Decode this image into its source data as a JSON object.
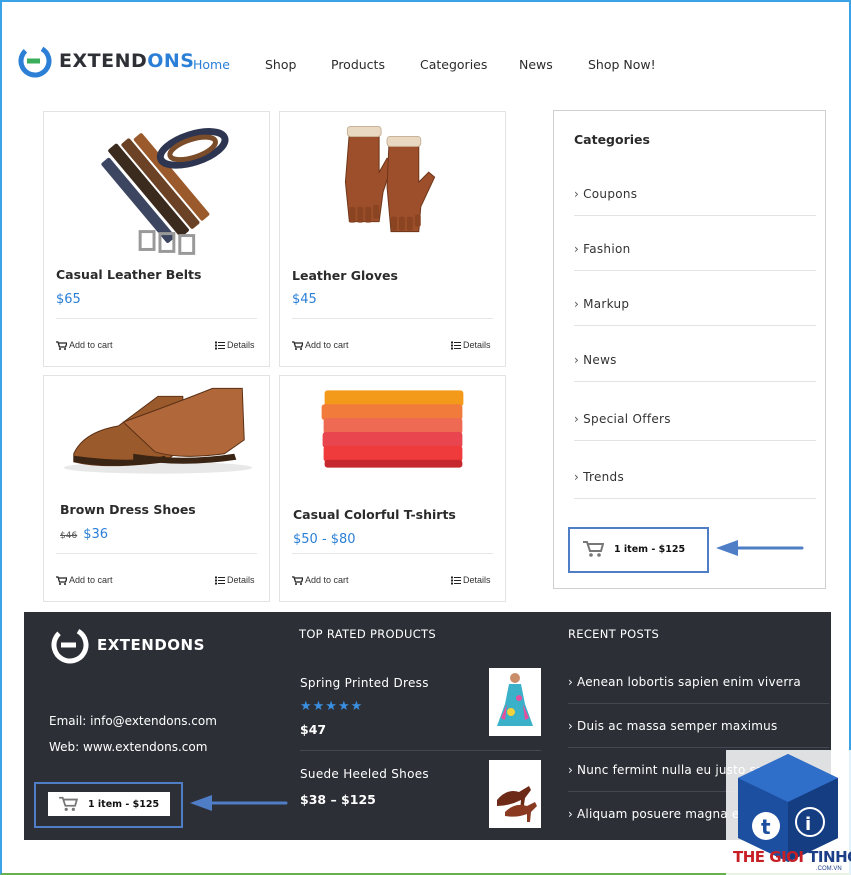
{
  "brand": {
    "name_part1": "EXTEND",
    "name_part2": "ONS",
    "accent_color": "#2b7fd6",
    "dark_color": "#2c2f36"
  },
  "nav": {
    "items": [
      {
        "label": "Home",
        "active": true
      },
      {
        "label": "Shop",
        "active": false
      },
      {
        "label": "Products",
        "active": false
      },
      {
        "label": "Categories",
        "active": false
      },
      {
        "label": "News",
        "active": false
      },
      {
        "label": "Shop Now!",
        "active": false
      }
    ]
  },
  "products": [
    {
      "title": "Casual Leather Belts",
      "price": "$65",
      "old_price": "",
      "icon": "belts-image",
      "add_to_cart": "Add to cart",
      "details": "Details"
    },
    {
      "title": "Leather Gloves",
      "price": "$45",
      "old_price": "",
      "icon": "gloves-image",
      "add_to_cart": "Add to cart",
      "details": "Details"
    },
    {
      "title": "Brown Dress Shoes",
      "price": "$36",
      "old_price": "$46",
      "icon": "shoes-image",
      "add_to_cart": "Add to cart",
      "details": "Details"
    },
    {
      "title": "Casual Colorful T-shirts",
      "price": "$50 - $80",
      "old_price": "",
      "icon": "tshirts-image",
      "add_to_cart": "Add to cart",
      "details": "Details"
    }
  ],
  "sidebar": {
    "title": "Categories",
    "categories": [
      "Coupons",
      "Fashion",
      "Markup",
      "News",
      "Special Offers",
      "Trends"
    ],
    "cart_text": "1 item - $125"
  },
  "footer": {
    "brand_name": "EXTENDONS",
    "email": "Email: info@extendons.com",
    "web": "Web: www.extendons.com",
    "cart_text": "1 item - $125",
    "top_rated_heading": "TOP RATED PRODUCTS",
    "top_rated": [
      {
        "name": "Spring Printed Dress",
        "price": "$47",
        "rating": "★★★★★",
        "icon": "dress-thumbnail"
      },
      {
        "name": "Suede Heeled Shoes",
        "price": "$38 – $125",
        "rating": "",
        "icon": "heels-thumbnail"
      }
    ],
    "recent_posts_heading": "RECENT POSTS",
    "recent_posts": [
      "Aenean lobortis sapien enim viverra",
      "Duis ac massa semper maximus",
      "Nunc fermint nulla eu justo sagittis",
      "Aliquam posuere magna eget bibendum"
    ]
  },
  "watermark": {
    "text_red": "THE GIOI ",
    "text_blue": "TINHOC",
    "sub": ".COM.VN"
  }
}
